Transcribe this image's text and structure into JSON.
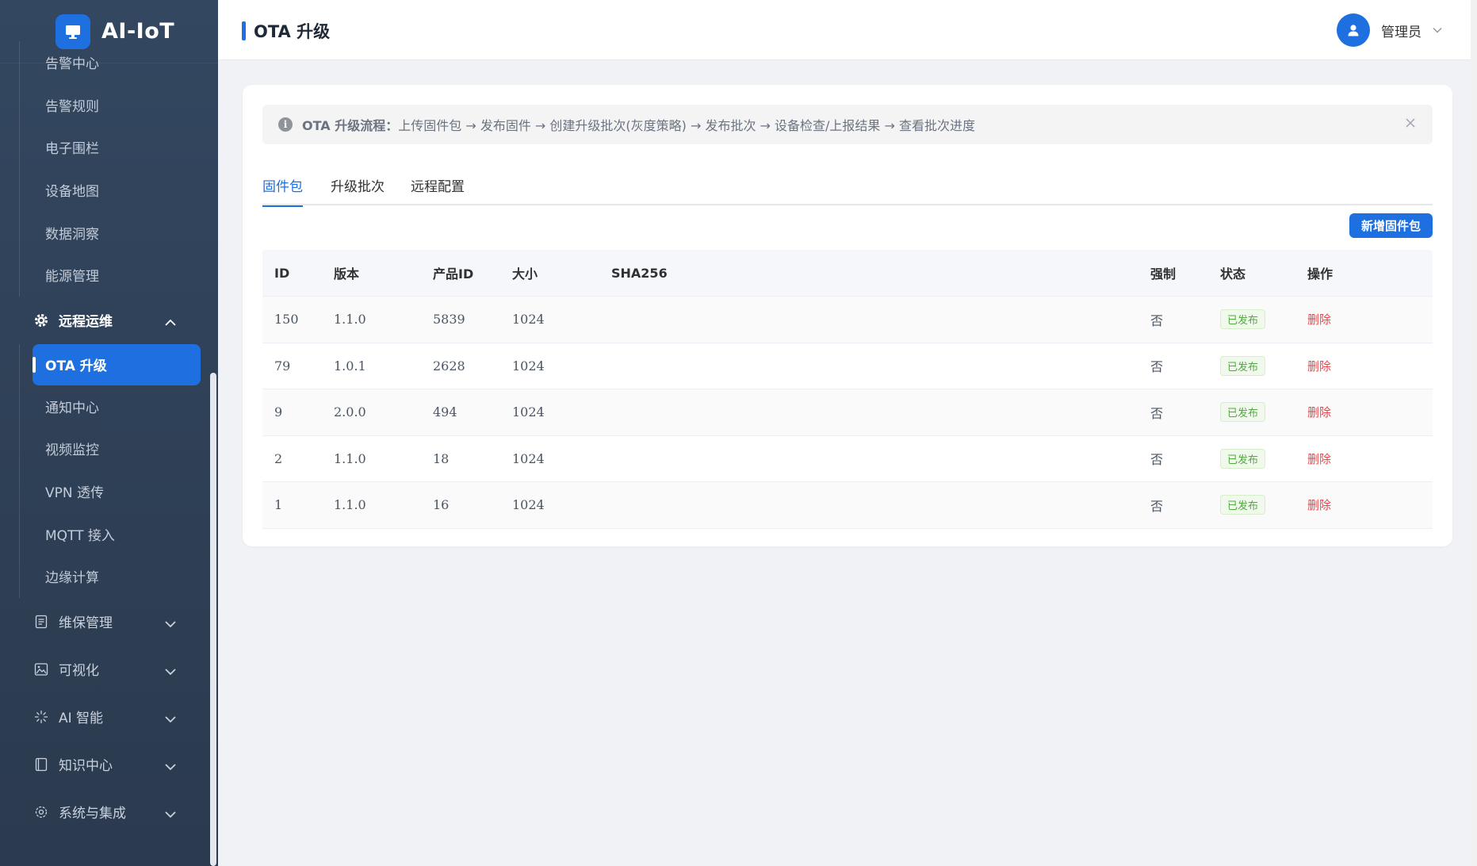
{
  "app": {
    "name": "AI-IoT"
  },
  "sidebar": {
    "top_items": [
      "告警中心",
      "告警规则",
      "电子围栏",
      "设备地图",
      "数据洞察",
      "能源管理"
    ],
    "open_group": {
      "label": "远程运维",
      "icon": "gear-icon"
    },
    "open_group_items": [
      "OTA 升级",
      "通知中心",
      "视频监控",
      "VPN 透传",
      "MQTT 接入",
      "边缘计算"
    ],
    "active_item": "OTA 升级",
    "groups": [
      {
        "label": "维保管理",
        "icon": "document-icon"
      },
      {
        "label": "可视化",
        "icon": "image-icon"
      },
      {
        "label": "AI 智能",
        "icon": "sparkle-icon"
      },
      {
        "label": "知识中心",
        "icon": "book-icon"
      },
      {
        "label": "系统与集成",
        "icon": "settings-icon"
      }
    ]
  },
  "header": {
    "title": "OTA 升级",
    "user": "管理员"
  },
  "alert": {
    "title": "OTA 升级流程：",
    "text": "上传固件包 → 发布固件 → 创建升级批次(灰度策略) → 发布批次 → 设备检查/上报结果 → 查看批次进度"
  },
  "tabs": [
    "固件包",
    "升级批次",
    "远程配置"
  ],
  "active_tab": "固件包",
  "add_button": "新增固件包",
  "table": {
    "columns": [
      "ID",
      "版本",
      "产品ID",
      "大小",
      "SHA256",
      "强制",
      "状态",
      "操作"
    ],
    "rows": [
      {
        "id": "150",
        "version": "1.1.0",
        "product_id": "5839",
        "size": "1024",
        "sha256": "",
        "force": "否",
        "status": "已发布",
        "action": "删除"
      },
      {
        "id": "79",
        "version": "1.0.1",
        "product_id": "2628",
        "size": "1024",
        "sha256": "",
        "force": "否",
        "status": "已发布",
        "action": "删除"
      },
      {
        "id": "9",
        "version": "2.0.0",
        "product_id": "494",
        "size": "1024",
        "sha256": "",
        "force": "否",
        "status": "已发布",
        "action": "删除"
      },
      {
        "id": "2",
        "version": "1.1.0",
        "product_id": "18",
        "size": "1024",
        "sha256": "",
        "force": "否",
        "status": "已发布",
        "action": "删除"
      },
      {
        "id": "1",
        "version": "1.1.0",
        "product_id": "16",
        "size": "1024",
        "sha256": "",
        "force": "否",
        "status": "已发布",
        "action": "删除"
      }
    ]
  },
  "colors": {
    "primary": "#1e6fe0",
    "sidebar_bg": "#334760",
    "danger": "#e5484d",
    "success": "#52a843"
  }
}
